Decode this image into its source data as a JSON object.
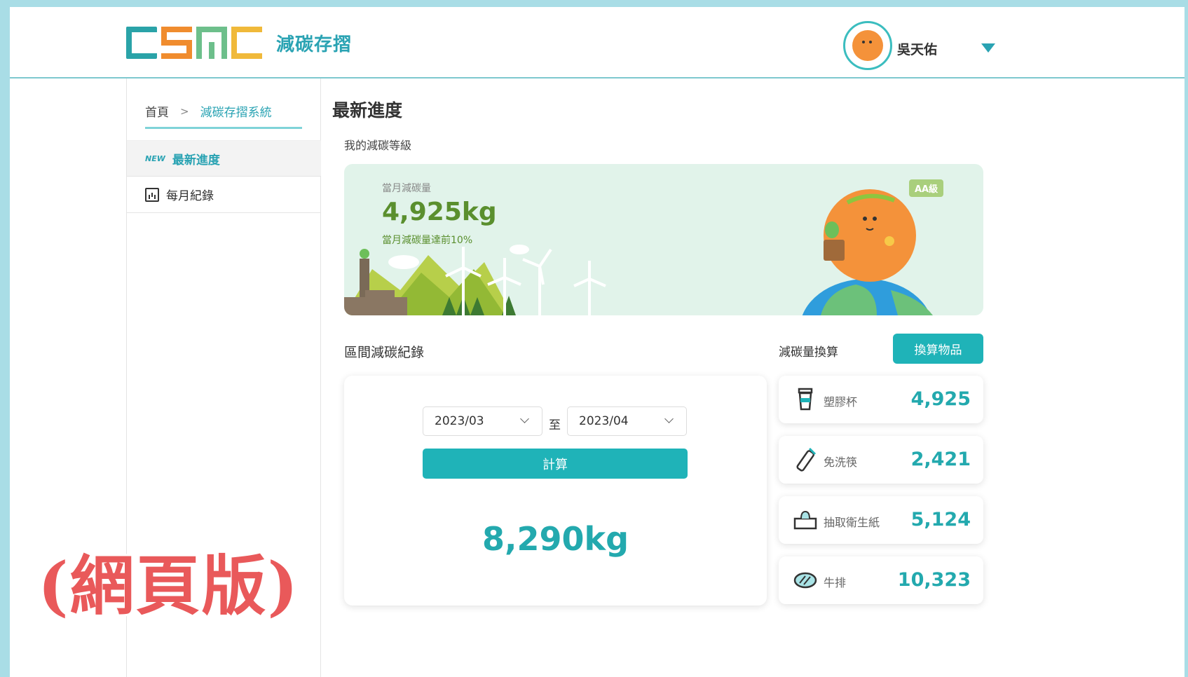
{
  "header": {
    "app_title": "減碳存摺",
    "user_name": "吳天佑"
  },
  "breadcrumb": {
    "home": "首頁",
    "separator": ">",
    "current": "減碳存摺系統"
  },
  "sidebar": {
    "items": [
      {
        "tag": "NEW",
        "label": "最新進度",
        "icon": "new-tag",
        "active": true
      },
      {
        "label": "每月紀錄",
        "icon": "bar-chart-icon",
        "active": false
      }
    ]
  },
  "main": {
    "title": "最新進度",
    "level_section_label": "我的減碳等級",
    "hero": {
      "monthly_label": "當月減碳量",
      "monthly_value": "4,925kg",
      "note": "當月減碳量達前10%",
      "level_badge": "AA級"
    },
    "interval": {
      "label": "區間減碳紀錄",
      "from_value": "2023/03",
      "to_word": "至",
      "to_value": "2023/04",
      "calculate_label": "計算",
      "total": "8,290kg"
    },
    "conversion": {
      "label": "減碳量換算",
      "button_label": "換算物品",
      "items": [
        {
          "icon": "cup-icon",
          "name": "塑膠杯",
          "value": "4,925"
        },
        {
          "icon": "chopsticks-icon",
          "name": "免洗筷",
          "value": "2,421"
        },
        {
          "icon": "tissue-box-icon",
          "name": "抽取衛生紙",
          "value": "5,124"
        },
        {
          "icon": "steak-icon",
          "name": "牛排",
          "value": "10,323"
        }
      ]
    }
  },
  "caption": "(網頁版)",
  "colors": {
    "accent": "#1fb3b8",
    "hero_bg": "#e1f3ea",
    "green_text": "#5a8f2e",
    "caption": "#e9595a",
    "page_border": "#a9dde6"
  }
}
